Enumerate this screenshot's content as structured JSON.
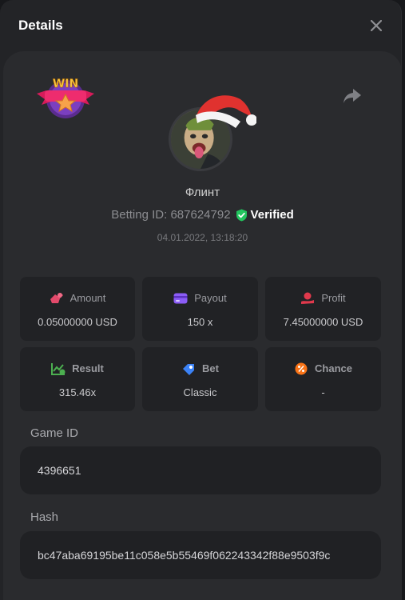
{
  "modal": {
    "title": "Details"
  },
  "player": {
    "name": "Флинт",
    "betting_label": "Betting ID: 687624792",
    "verified_label": "Verified",
    "timestamp": "04.01.2022, 13:18:20"
  },
  "badge": {
    "text": "WIN"
  },
  "stats": [
    {
      "label": "Amount",
      "value": "0.05000000 USD",
      "icon": "amount-icon",
      "color": "#e34a6b"
    },
    {
      "label": "Payout",
      "value": "150 x",
      "icon": "payout-icon",
      "color": "#8b5cf6"
    },
    {
      "label": "Profit",
      "value": "7.45000000 USD",
      "icon": "profit-icon",
      "color": "#e0394c"
    },
    {
      "label": "Result",
      "value": "315.46x",
      "icon": "result-icon",
      "color": "#4caf50"
    },
    {
      "label": "Bet",
      "value": "Classic",
      "icon": "bet-icon",
      "color": "#3b82f6"
    },
    {
      "label": "Chance",
      "value": "-",
      "icon": "chance-icon",
      "color": "#f97316"
    }
  ],
  "game": {
    "label": "Game ID",
    "value": "4396651"
  },
  "hash": {
    "label": "Hash",
    "value": "bc47aba69195be11c058e5b55469f062243342f88e9503f9c"
  },
  "colors": {
    "verified": "#22c55e",
    "badge_pink": "#e91e63",
    "badge_gold": "#f5c542"
  }
}
